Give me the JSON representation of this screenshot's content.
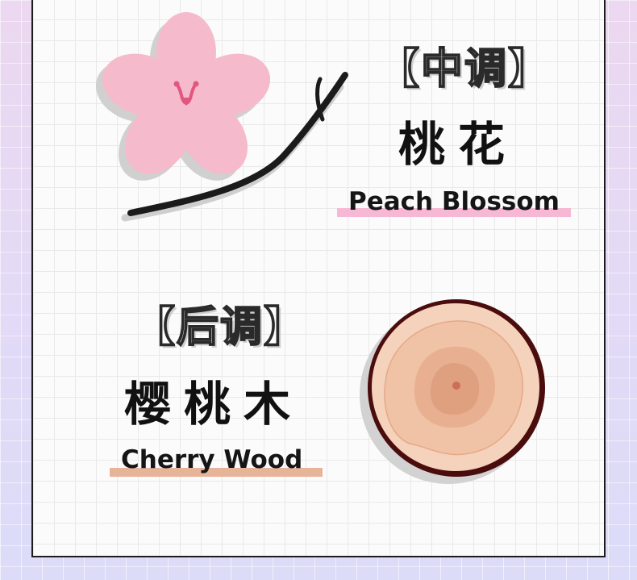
{
  "top_note": {
    "tag": "【中调】",
    "name_cn": "桃花",
    "name_en": "Peach Blossom",
    "highlight_color": "#f6b8d4",
    "icon": "peach-blossom-icon"
  },
  "base_note": {
    "tag": "【后调】",
    "name_cn": "樱桃木",
    "name_en": "Cherry Wood",
    "highlight_color": "#e7b49a",
    "icon": "wood-slice-icon"
  }
}
